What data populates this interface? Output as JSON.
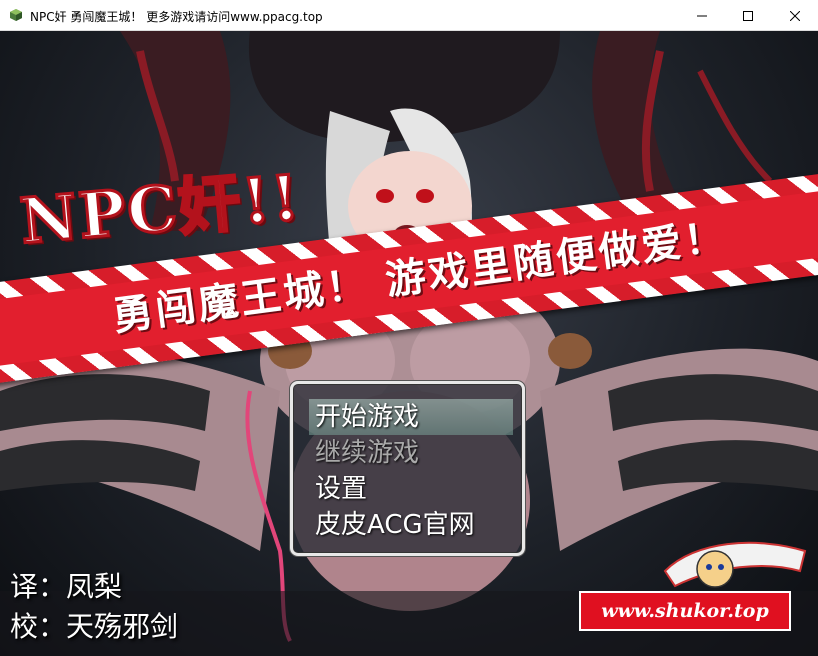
{
  "window": {
    "title": "NPC奸 勇闯魔王城！ 更多游戏请访问www.ppacg.top",
    "icon": "app-icon"
  },
  "game": {
    "logo_main": "NPC奸!!",
    "logo_banner": "勇闯魔王城！ 游戏里随便做爱！",
    "menu": {
      "items": [
        {
          "label": "开始游戏",
          "state": "selected"
        },
        {
          "label": "继续游戏",
          "state": "disabled"
        },
        {
          "label": "设置",
          "state": "normal"
        },
        {
          "label": "皮皮ACG官网",
          "state": "normal"
        }
      ]
    },
    "credits": {
      "translator": {
        "label": "译：",
        "name": "凤梨"
      },
      "proofreader": {
        "label": "校：",
        "name": "天殇邪剑"
      }
    },
    "badge_url": "www.shukor.top"
  },
  "colors": {
    "banner_red": "#e21f2e",
    "menu_selected": "#9ccbbd",
    "badge_red": "#e01020"
  }
}
